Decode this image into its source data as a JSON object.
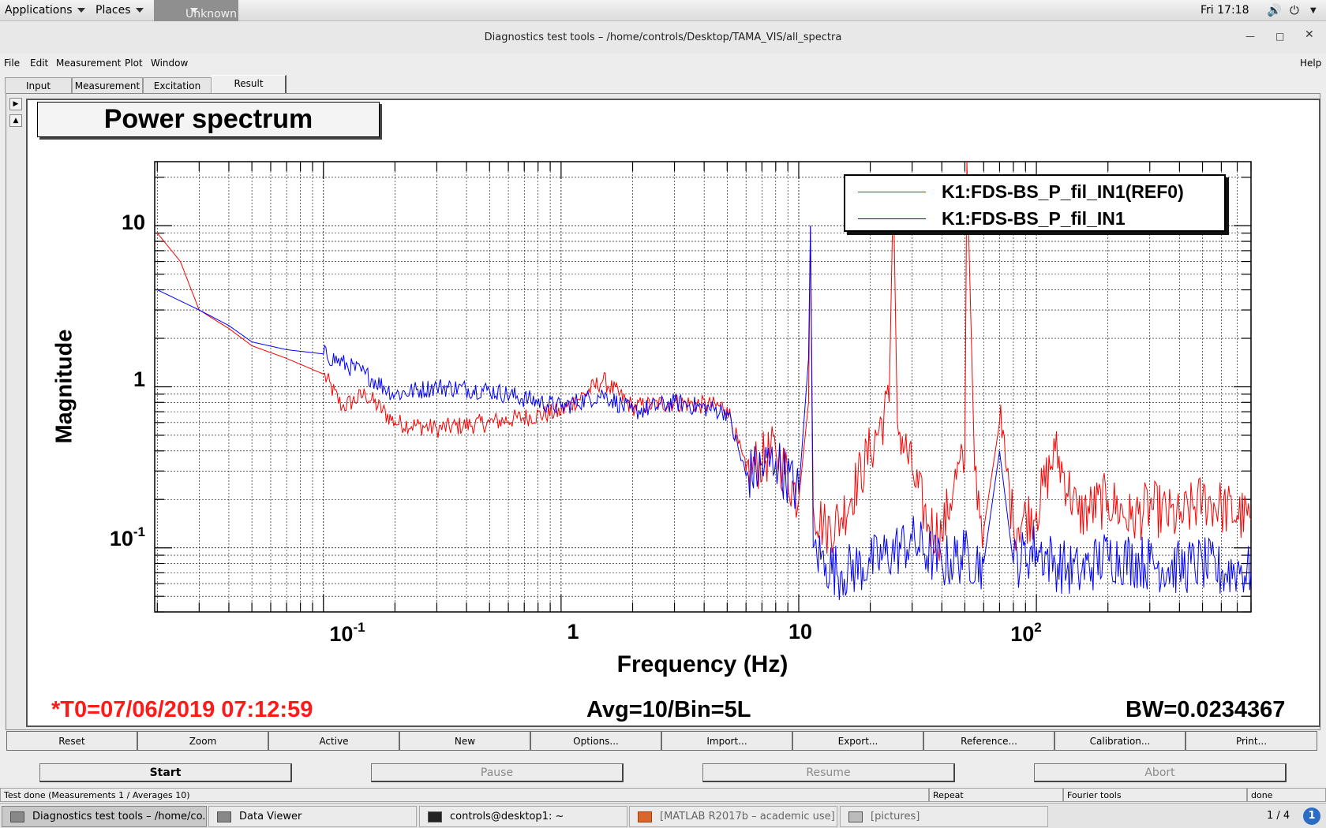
{
  "topbar": {
    "applications": "Applications",
    "places": "Places",
    "unknown": "Unknown",
    "clock": "Fri 17:18"
  },
  "window": {
    "title": "Diagnostics test tools – /home/controls/Desktop/TAMA_VIS/all_spectra"
  },
  "menubar": {
    "file": "File",
    "edit": "Edit",
    "measurement": "Measurement",
    "plot": "Plot",
    "window": "Window",
    "help": "Help"
  },
  "tabs": [
    {
      "label": "Input"
    },
    {
      "label": "Measurement"
    },
    {
      "label": "Excitation"
    },
    {
      "label": "Result"
    }
  ],
  "graph": {
    "title": "Power spectrum",
    "ylabel": "Magnitude",
    "xlabel": "Frequency (Hz)",
    "t0": "*T0=07/06/2019 07:12:59",
    "avg": "Avg=10/Bin=5L",
    "bw": "BW=0.0234367",
    "yticks": {
      "t10": "10",
      "t1": "1",
      "t01_base": "10",
      "t01_exp": "-1"
    },
    "xticks": {
      "t01_base": "10",
      "t01_exp": "-1",
      "t1": "1",
      "t10": "10",
      "t100_base": "10",
      "t100_exp": "2"
    }
  },
  "chart_data": {
    "type": "line",
    "title": "Power spectrum",
    "xlabel": "Frequency (Hz)",
    "ylabel": "Magnitude",
    "xscale": "log",
    "yscale": "log",
    "xlim": [
      0.0195,
      800
    ],
    "ylim": [
      0.04,
      25
    ],
    "grid": true,
    "legend_position": "top-right",
    "series": [
      {
        "name": "K1:FDS-BS_P_fil_IN1(REF0)",
        "color": "#ff0000",
        "x": [
          0.02,
          0.025,
          0.03,
          0.04,
          0.05,
          0.07,
          0.1,
          0.12,
          0.15,
          0.2,
          0.3,
          0.5,
          1,
          1.5,
          2,
          3,
          5,
          6,
          8,
          10,
          11,
          11.2,
          11.5,
          13,
          15,
          20,
          24,
          25,
          26,
          30,
          35,
          40,
          45,
          50,
          51,
          55,
          60,
          70,
          75,
          80,
          100,
          120,
          150,
          200,
          250,
          300,
          400,
          500,
          600,
          700,
          800
        ],
        "y": [
          9.0,
          6.0,
          3.0,
          2.3,
          1.8,
          1.5,
          1.2,
          0.75,
          0.9,
          0.6,
          0.55,
          0.6,
          0.7,
          1.1,
          0.75,
          0.8,
          0.75,
          0.3,
          0.4,
          0.2,
          0.8,
          10.0,
          0.18,
          0.13,
          0.15,
          0.4,
          0.8,
          18.0,
          0.6,
          0.3,
          0.14,
          0.12,
          0.25,
          0.35,
          30.0,
          0.3,
          0.13,
          0.6,
          0.3,
          0.14,
          0.17,
          0.4,
          0.16,
          0.2,
          0.15,
          0.18,
          0.15,
          0.2,
          0.18,
          0.16,
          0.15
        ]
      },
      {
        "name": "K1:FDS-BS_P_fil_IN1",
        "color": "#0000ff",
        "x": [
          0.02,
          0.03,
          0.04,
          0.05,
          0.07,
          0.1,
          0.15,
          0.2,
          0.3,
          0.5,
          1,
          1.5,
          2,
          3,
          5,
          6,
          8,
          10,
          11,
          11.2,
          11.5,
          13,
          15,
          20,
          30,
          40,
          50,
          60,
          70,
          80,
          100,
          120,
          150,
          200,
          300,
          400,
          500,
          600,
          700,
          800
        ],
        "y": [
          4.0,
          3.0,
          2.4,
          1.9,
          1.7,
          1.6,
          1.2,
          0.9,
          1.0,
          0.95,
          0.75,
          0.9,
          0.7,
          0.8,
          0.7,
          0.28,
          0.35,
          0.22,
          1.5,
          10.0,
          0.1,
          0.08,
          0.07,
          0.08,
          0.11,
          0.08,
          0.09,
          0.08,
          0.4,
          0.08,
          0.1,
          0.08,
          0.07,
          0.09,
          0.08,
          0.075,
          0.08,
          0.07,
          0.075,
          0.07
        ]
      }
    ]
  },
  "buttons": {
    "reset": "Reset",
    "zoom": "Zoom",
    "active": "Active",
    "new": "New",
    "options": "Options...",
    "import": "Import...",
    "export": "Export...",
    "reference": "Reference...",
    "calibration": "Calibration...",
    "print": "Print..."
  },
  "controls": {
    "start": "Start",
    "pause": "Pause",
    "resume": "Resume",
    "abort": "Abort"
  },
  "status": {
    "main": "Test done (Measurements 1 / Averages 10)",
    "repeat": "Repeat",
    "tool": "Fourier tools",
    "state": "done"
  },
  "taskbar": {
    "items": [
      {
        "label": "Diagnostics test tools – /home/co..."
      },
      {
        "label": "Data Viewer"
      },
      {
        "label": "controls@desktop1: ~"
      },
      {
        "label": "[MATLAB R2017b – academic use]"
      },
      {
        "label": "[pictures]"
      }
    ],
    "pager": "1 / 4",
    "info": "1"
  }
}
